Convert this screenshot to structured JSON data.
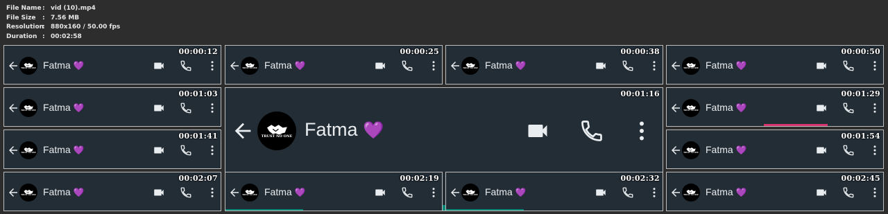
{
  "file_info": {
    "name_label": "File Name",
    "name_value": "vid (10).mp4",
    "size_label": "File Size",
    "size_value": "7.56 MB",
    "resolution_label": "Resolution",
    "resolution_value": "880x160 / 50.00 fps",
    "duration_label": "Duration",
    "duration_value": "00:02:58",
    "separator": ":"
  },
  "chat": {
    "contact_name": "Fatma",
    "heart": "💜",
    "avatar_text": "TRUST NO ONE"
  },
  "colors": {
    "header_bg": "#232d36",
    "text": "#e9edef",
    "accent_strip": "#0b8a79",
    "pink_strip": "#d6336c"
  },
  "thumbnails": [
    {
      "time": "00:00:12"
    },
    {
      "time": "00:00:25"
    },
    {
      "time": "00:00:38"
    },
    {
      "time": "00:00:50"
    },
    {
      "time": "00:01:03"
    },
    {
      "time": "00:01:16"
    },
    {
      "time": "00:01:29"
    },
    {
      "time": "00:01:41"
    },
    {
      "time": "00:01:54"
    },
    {
      "time": "00:02:07"
    },
    {
      "time": "00:02:19"
    },
    {
      "time": "00:02:32"
    },
    {
      "time": "00:02:45"
    }
  ]
}
